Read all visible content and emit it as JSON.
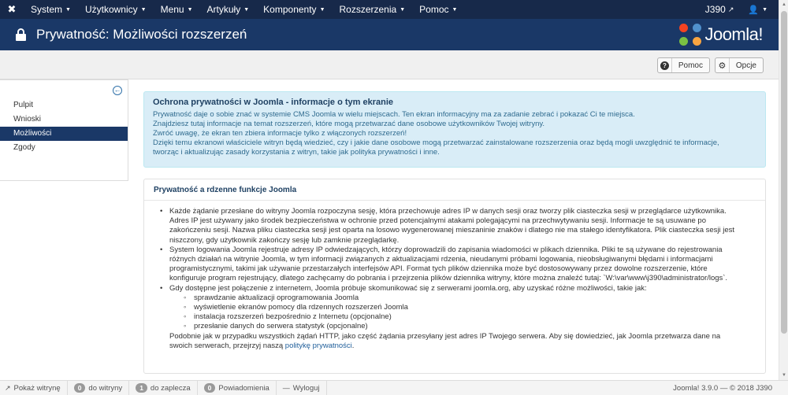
{
  "navbar": {
    "logo_icon": "joomla-x-icon",
    "menu": [
      {
        "label": "System"
      },
      {
        "label": "Użytkownicy"
      },
      {
        "label": "Menu"
      },
      {
        "label": "Artykuły"
      },
      {
        "label": "Komponenty"
      },
      {
        "label": "Rozszerzenia"
      },
      {
        "label": "Pomoc"
      }
    ],
    "site_label": "J390",
    "user_icon": "user-icon"
  },
  "title_bar": {
    "title": "Prywatność: Możliwości rozszerzeń",
    "logo_text": "Joomla!",
    "bg_color": "#1a3867"
  },
  "toolbar": {
    "help_label": "Pomoc",
    "options_label": "Opcje"
  },
  "sidebar": {
    "items": [
      {
        "label": "Pulpit",
        "active": false
      },
      {
        "label": "Wnioski",
        "active": false
      },
      {
        "label": "Możliwości",
        "active": true
      },
      {
        "label": "Zgody",
        "active": false
      }
    ]
  },
  "info_box": {
    "title": "Ochrona prywatności w Joomla - informacje o tym ekranie",
    "lines": [
      "Prywatność daje o sobie znać w systemie CMS Joomla w wielu miejscach. Ten ekran informacyjny ma za zadanie zebrać i pokazać Ci te miejsca.",
      "Znajdziesz tutaj informacje na temat rozszerzeń, które mogą przetwarzać dane osobowe użytkowników Twojej witryny.",
      "Zwróć uwagę, że ekran ten zbiera informacje tylko z włączonych rozszerzeń!",
      "Dzięki temu ekranowi właściciele witryn będą wiedzieć, czy i jakie dane osobowe mogą przetwarzać zainstalowane rozszerzenia oraz będą mogli uwzględnić te informacje,",
      "tworząc i aktualizując zasady korzystania z witryn, takie jak polityka prywatności i inne."
    ]
  },
  "panel": {
    "title": "Prywatność a rdzenne funkcje Joomla",
    "bullet1": [
      "Każde żądanie przesłane do witryny Joomla rozpoczyna sesję, która przechowuje adres IP w danych sesji oraz tworzy plik ciasteczka sesji w przeglądarce użytkownika.",
      "Adres IP jest używany jako środek bezpieczeństwa w ochronie przed potencjalnymi atakami polegającymi na przechwytywaniu sesji. Informacje te są usuwane po",
      "zakończeniu sesji. Nazwa pliku ciasteczka sesji jest oparta na losowo wygenerowanej mieszaninie znaków i dlatego nie ma stałego identyfikatora. Plik ciasteczka sesji jest",
      "niszczony, gdy użytkownik zakończy sesję lub zamknie przeglądarkę."
    ],
    "bullet2": [
      "System logowania Joomla rejestruje adresy IP odwiedzających, którzy doprowadzili do zapisania wiadomości w plikach dziennika. Pliki te są używane do rejestrowania",
      "różnych działań na witrynie Joomla, w tym informacji związanych z aktualizacjami rdzenia, nieudanymi próbami logowania, nieobsługiwanymi błędami i informacjami",
      "programistycznymi, takimi jak używanie przestarzałych interfejsów API. Format tych plików dziennika może być dostosowywany przez dowolne rozszerzenie, które",
      "konfiguruje program rejestrujący, dlatego zachęcamy do pobrania i przejrzenia plików dziennika witryny, które można znaleźć tutaj: `W:\\var\\www\\j390\\administrator/logs`."
    ],
    "bullet3_intro": "Gdy dostępne jest połączenie z internetem, Joomla próbuje skomunikować się z serwerami joomla.org, aby uzyskać różne możliwości, takie jak:",
    "sub_items": [
      "sprawdzanie aktualizacji oprogramowania Joomla",
      "wyświetlenie ekranów pomocy dla rdzennych rozszerzeń Joomla",
      "instalacja rozszerzeń bezpośrednio z Internetu (opcjonalne)",
      "przesłanie danych do serwera statystyk (opcjonalne)"
    ],
    "footer_line1": "Podobnie jak w przypadku wszystkich żądań HTTP, jako część żądania przesyłany jest adres IP Twojego serwera. Aby się dowiedzieć, jak Joomla przetwarza dane na",
    "footer_line2_prefix": "swoich serwerach, przejrzyj naszą ",
    "footer_link": "politykę prywatności",
    "footer_line2_suffix": "."
  },
  "statusbar": {
    "view_site": "Pokaż witrynę",
    "visitors_count": "0",
    "visitors_label": "do witryny",
    "backend_count": "1",
    "backend_label": "do zaplecza",
    "messages_count": "0",
    "messages_label": "Powiadomienia",
    "logout": "Wyloguj",
    "version": "Joomla! 3.9.0  —  © 2018 J390"
  }
}
